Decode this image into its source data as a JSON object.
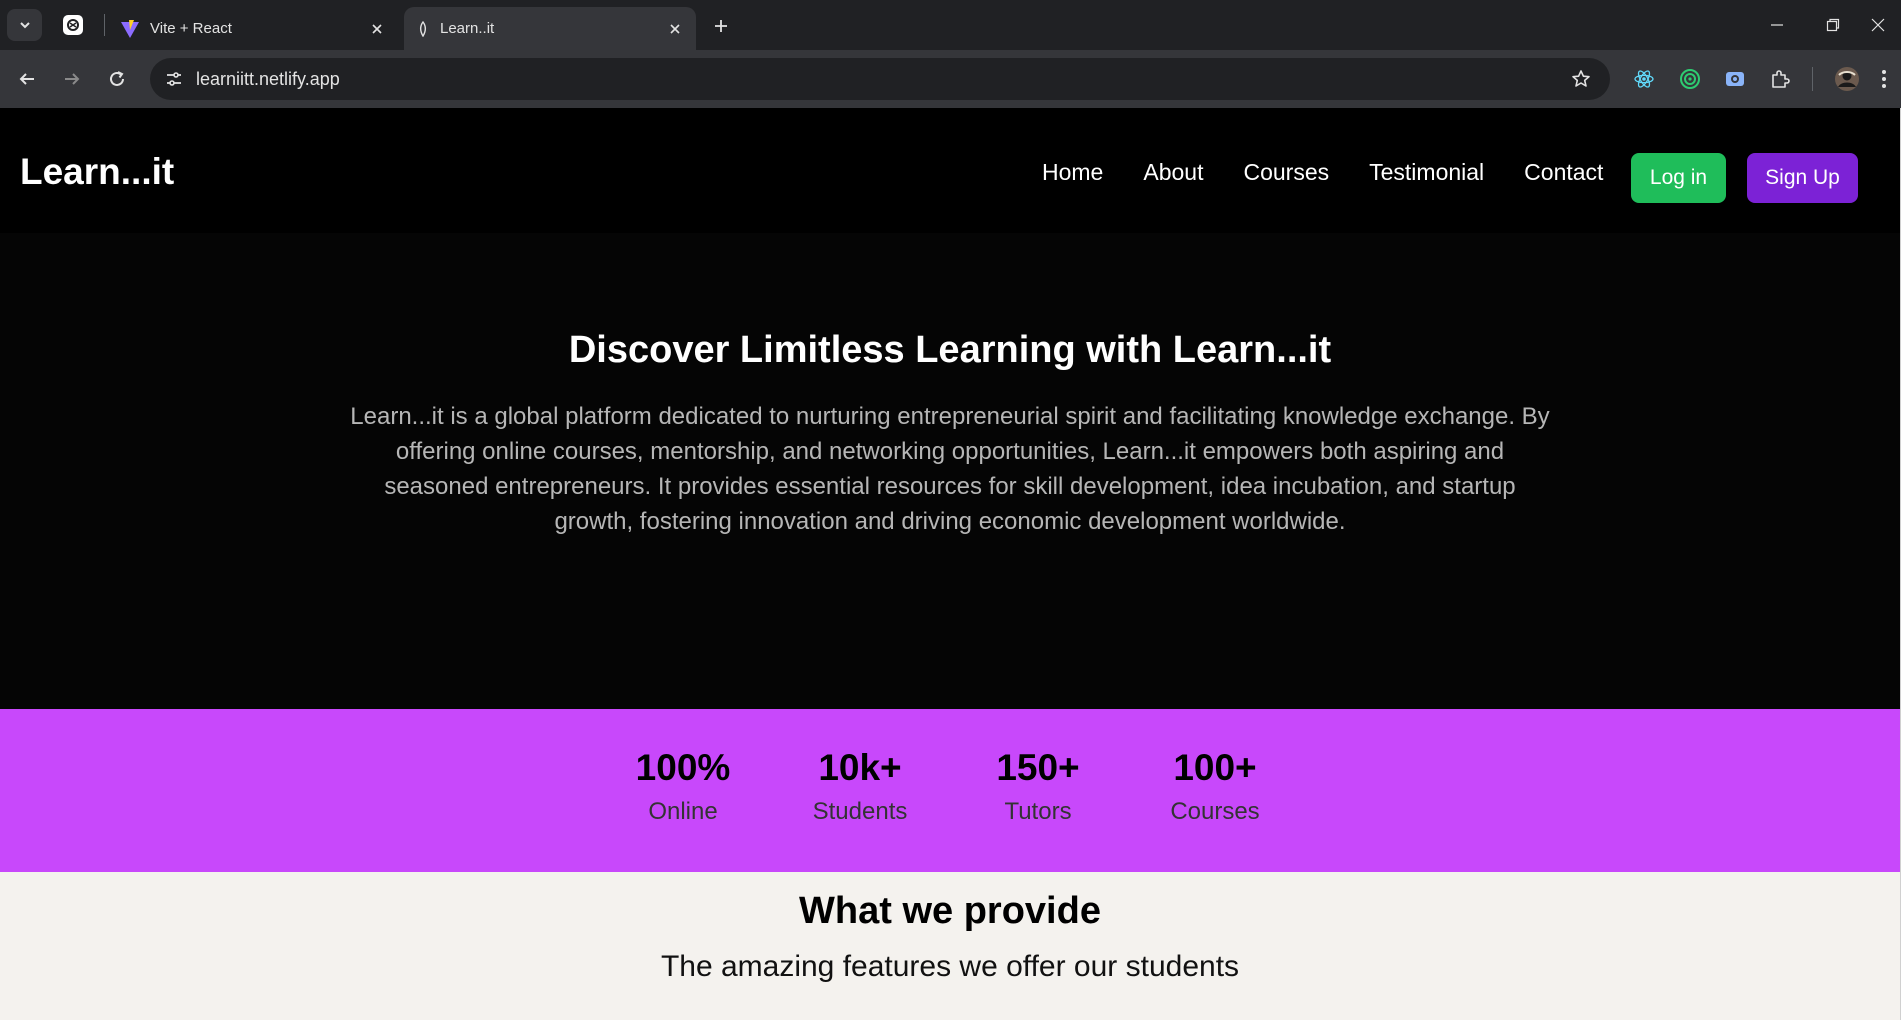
{
  "browser": {
    "tabs": [
      {
        "title": "Vite + React"
      },
      {
        "title": "Learn..it"
      }
    ],
    "address": "learniitt.netlify.app"
  },
  "colors": {
    "login_button": "#1fbd5a",
    "signup_button": "#7c22d6",
    "stats_background": "#c848fb"
  },
  "site": {
    "brand": "Learn...it",
    "nav": [
      "Home",
      "About",
      "Courses",
      "Testimonial",
      "Contact"
    ],
    "login_label": "Log in",
    "signup_label": "Sign Up"
  },
  "hero": {
    "title": "Discover Limitless Learning with Learn...it",
    "description": "Learn...it is a global platform dedicated to nurturing entrepreneurial spirit and facilitating knowledge exchange. By offering online courses, mentorship, and networking opportunities, Learn...it empowers both aspiring and seasoned entrepreneurs. It provides essential resources for skill development, idea incubation, and startup growth, fostering innovation and driving economic development worldwide."
  },
  "stats": [
    {
      "value": "100%",
      "label": "Online"
    },
    {
      "value": "10k+",
      "label": "Students"
    },
    {
      "value": "150+",
      "label": "Tutors"
    },
    {
      "value": "100+",
      "label": "Courses"
    }
  ],
  "provide": {
    "title": "What we provide",
    "subtitle": "The amazing features we offer our students"
  }
}
